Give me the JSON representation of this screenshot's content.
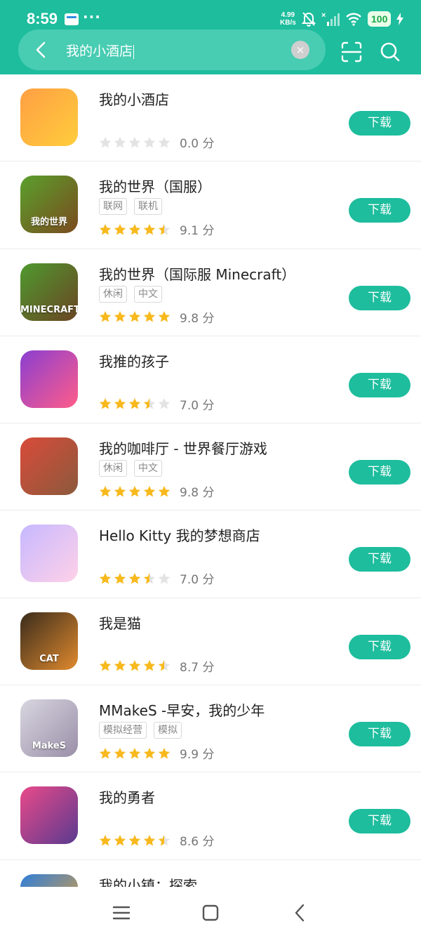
{
  "status_bar": {
    "time": "8:59",
    "more": "···",
    "net_speed_value": "4.99",
    "net_speed_unit": "KB/s",
    "battery": "100"
  },
  "search": {
    "query": "我的小酒店",
    "clear_label": "×"
  },
  "download_label": "下载",
  "rating_unit": "分",
  "apps": [
    {
      "name": "我的小酒店",
      "tags": [],
      "stars": 0,
      "score": "0.0",
      "icon_colors": [
        "#ff9f43",
        "#ffcd3c"
      ],
      "icon_text": ""
    },
    {
      "name": "我的世界（国服）",
      "tags": [
        "联网",
        "联机"
      ],
      "stars": 4.5,
      "score": "9.1",
      "icon_colors": [
        "#5aa02c",
        "#7b4a1f"
      ],
      "icon_text": "我的世界"
    },
    {
      "name": "我的世界（国际服 Minecraft）",
      "tags": [
        "休闲",
        "中文"
      ],
      "stars": 5,
      "score": "9.8",
      "icon_colors": [
        "#4f9a2f",
        "#6b4423"
      ],
      "icon_text": "MINECRAFT"
    },
    {
      "name": "我推的孩子",
      "tags": [],
      "stars": 3.5,
      "score": "7.0",
      "icon_colors": [
        "#8a3fd1",
        "#ff5c8a"
      ],
      "icon_text": ""
    },
    {
      "name": "我的咖啡厅 - 世界餐厅游戏",
      "tags": [
        "休闲",
        "中文"
      ],
      "stars": 5,
      "score": "9.8",
      "icon_colors": [
        "#d94b3a",
        "#8b5a3c"
      ],
      "icon_text": ""
    },
    {
      "name": "Hello Kitty 我的梦想商店",
      "tags": [],
      "stars": 3.5,
      "score": "7.0",
      "icon_colors": [
        "#c6b8ff",
        "#ffd1e8"
      ],
      "icon_text": ""
    },
    {
      "name": "我是猫",
      "tags": [],
      "stars": 4.5,
      "score": "8.7",
      "icon_colors": [
        "#3a2c1c",
        "#e08a2e"
      ],
      "icon_text": "CAT"
    },
    {
      "name": "MMakeS -早安，我的少年",
      "tags": [
        "模拟经营",
        "模拟"
      ],
      "stars": 5,
      "score": "9.9",
      "icon_colors": [
        "#d8d6e0",
        "#9a8fa8"
      ],
      "icon_text": "MakeS"
    },
    {
      "name": "我的勇者",
      "tags": [],
      "stars": 4.5,
      "score": "8.6",
      "icon_colors": [
        "#e94a8a",
        "#5a3a8f"
      ],
      "icon_text": ""
    },
    {
      "name": "我的小镇：探索",
      "tags": [],
      "stars": 0,
      "score": "",
      "icon_colors": [
        "#2f7fd8",
        "#f0a030"
      ],
      "icon_text": ""
    }
  ],
  "colors": {
    "brand": "#1dbd9d",
    "star_on": "#f8b91e",
    "star_off": "#e3e3e3"
  },
  "icons": {
    "back": "chevron-left-icon",
    "scan": "scan-icon",
    "search": "search-icon",
    "nav_menu": "menu-icon",
    "nav_home": "home-square-icon",
    "nav_back": "back-chevron-icon"
  }
}
